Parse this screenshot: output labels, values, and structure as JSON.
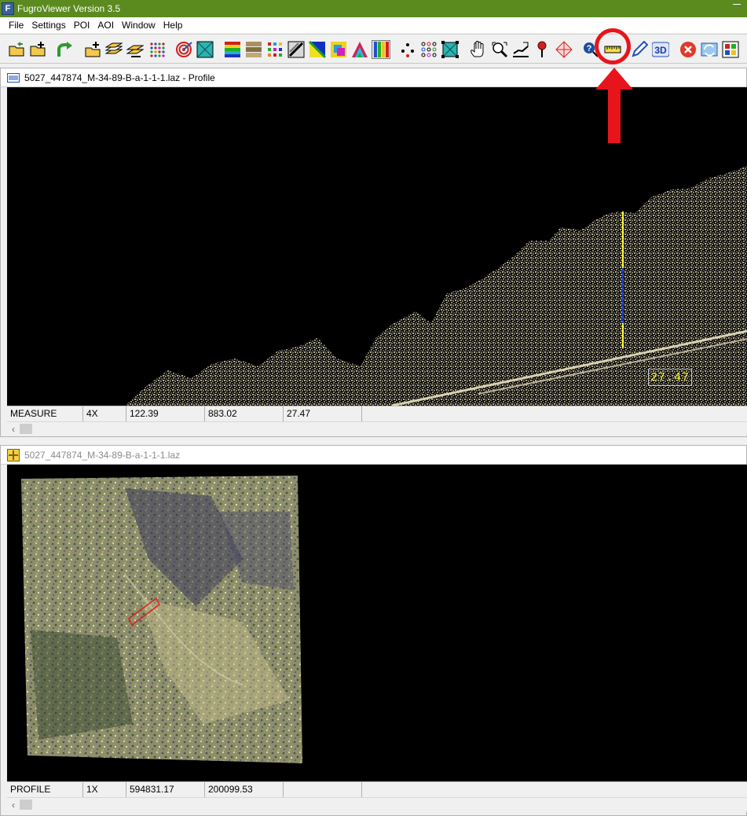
{
  "app": {
    "title": "FugroViewer  Version 3.5",
    "icon_letter": "F"
  },
  "menu": [
    "File",
    "Settings",
    "POI",
    "AOI",
    "Window",
    "Help"
  ],
  "toolbar": {
    "buttons": [
      "open-file-icon",
      "add-file-icon",
      "redo-arrow-icon",
      "add-layer-icon",
      "layers-icon",
      "layer-settings-icon",
      "point-grid-icon",
      "target-icon",
      "tin-icon",
      "elevation-color-icon",
      "intensity-icon",
      "rgb-points-icon",
      "slope-icon",
      "shaded-relief-icon",
      "classification-icon",
      "contour-icon",
      "bar-color-icon",
      "points-dots-icon",
      "point-matrix-icon",
      "tin-mesh-icon",
      "pan-hand-icon",
      "zoom-icon",
      "profile-tool-icon",
      "poi-pin-icon",
      "target-cursor-icon",
      "identify-icon",
      "measure-ruler-icon",
      "pencil-icon",
      "3d-view-icon",
      "close-red-icon",
      "refresh-icon",
      "grid-view-icon"
    ],
    "label_3d": "3D"
  },
  "annotation": {
    "highlighted_button": "measure-ruler-icon",
    "color": "#e8141b"
  },
  "profile_window": {
    "title": "5027_447874_M-34-89-B-a-1-1-1.laz - Profile",
    "measurement_value": "27.47",
    "status": {
      "mode": "MEASURE",
      "zoom": "4X",
      "x": "122.39",
      "y": "883.02",
      "value": "27.47",
      "extra": ""
    }
  },
  "plan_window": {
    "title": "5027_447874_M-34-89-B-a-1-1-1.laz",
    "status": {
      "mode": "PROFILE",
      "zoom": "1X",
      "x": "594831.17",
      "y": "200099.53",
      "value": "",
      "extra": ""
    }
  },
  "colors": {
    "titlebar": "#5b8a1e",
    "canvas_bg": "#000000",
    "measure_text": "#ffff33",
    "point_cloud": "#e8e3b8"
  }
}
